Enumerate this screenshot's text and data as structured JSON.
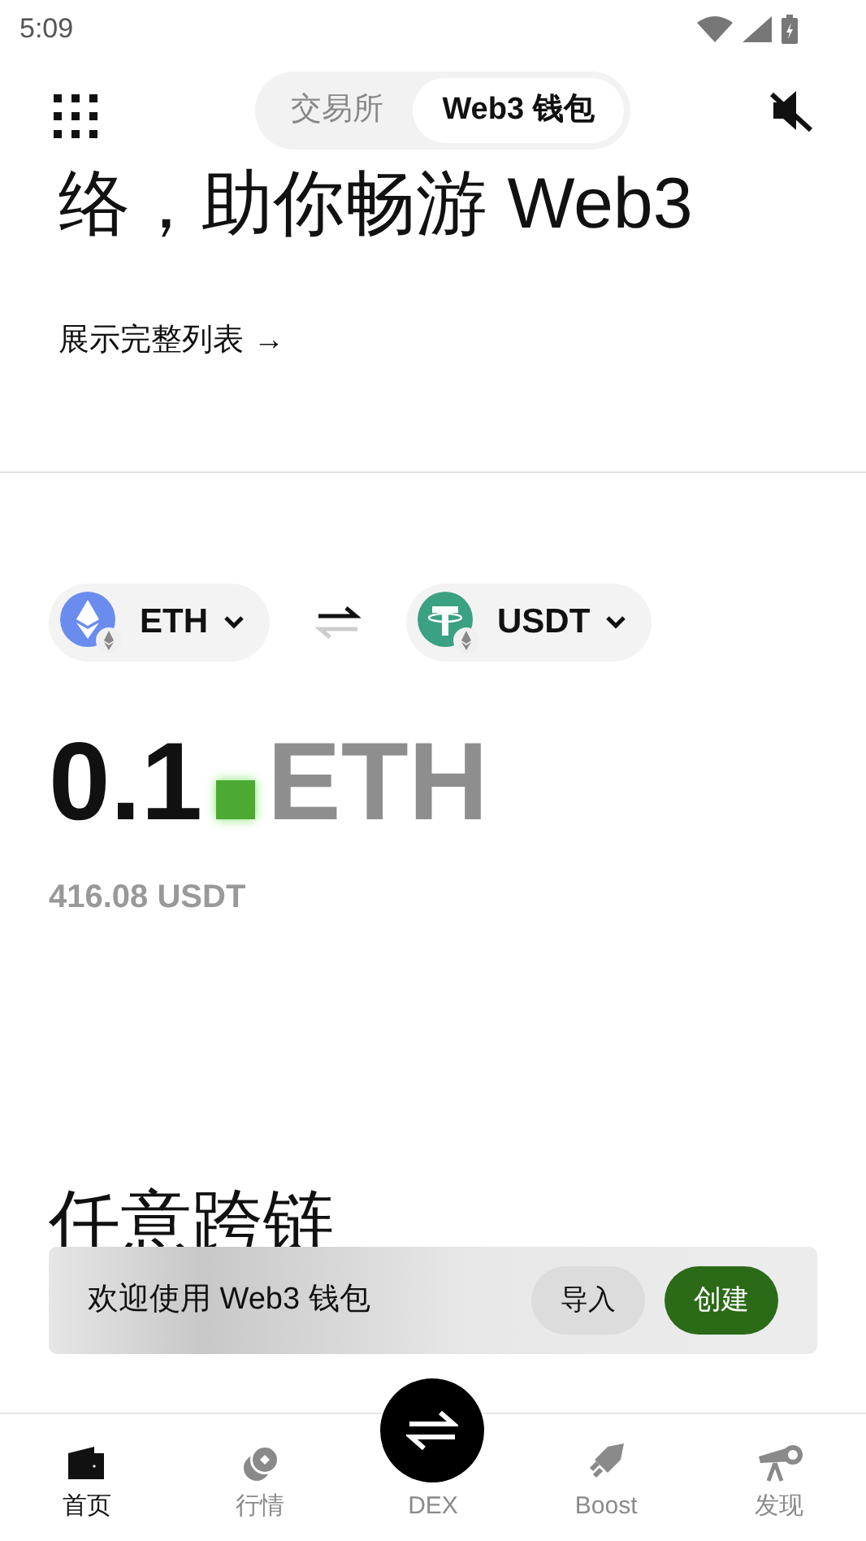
{
  "status_bar": {
    "time": "5:09"
  },
  "top_tabs": [
    {
      "label": "交易所",
      "selected": false
    },
    {
      "label": "Web3 钱包",
      "selected": true
    }
  ],
  "hero": {
    "headline": "络，助你畅游 Web3",
    "link": "展示完整列表",
    "link_arrow": "→"
  },
  "swap": {
    "from_token": {
      "symbol": "ETH",
      "kind": "eth"
    },
    "to_token": {
      "symbol": "USDT",
      "kind": "usdt"
    },
    "amount": "0.1",
    "unit": "ETH",
    "converted": "416.08 USDT"
  },
  "section_heading": "任意跨链",
  "banner": {
    "message": "欢迎使用 Web3 钱包",
    "buttons": [
      {
        "label": "导入",
        "kind": "secondary"
      },
      {
        "label": "创建",
        "kind": "primary"
      }
    ]
  },
  "bottom_nav": [
    {
      "label": "首页",
      "kind": "wallet",
      "selected": true
    },
    {
      "label": "行情",
      "kind": "coins",
      "selected": false
    },
    {
      "label": "DEX",
      "kind": "swap",
      "selected": false
    },
    {
      "label": "Boost",
      "kind": "rocket",
      "selected": false
    },
    {
      "label": "发现",
      "kind": "telescope",
      "selected": false
    }
  ]
}
